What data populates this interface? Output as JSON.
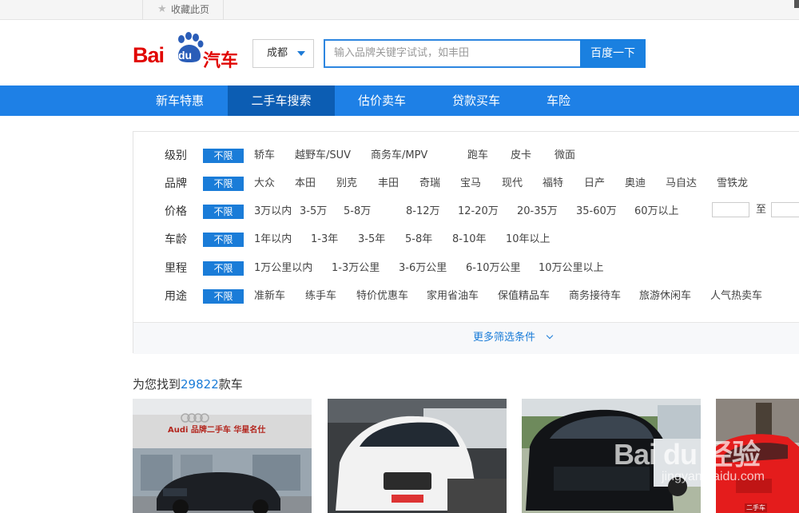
{
  "topbar": {
    "favorite_label": "收藏此页",
    "star_icon": "star-icon"
  },
  "logo": {
    "bai": "Bai",
    "du": "du",
    "qiche": "汽车"
  },
  "search": {
    "city": "成都",
    "placeholder": "输入品牌关键字试试，如丰田",
    "button": "百度一下"
  },
  "nav": {
    "items": [
      "新车特惠",
      "二手车搜索",
      "估价卖车",
      "贷款买车",
      "车险"
    ],
    "active": 1
  },
  "filters": {
    "no_limit": "不限",
    "rows": [
      {
        "label": "级别",
        "options": [
          "轿车",
          "越野车/SUV",
          "商务车/MPV",
          "跑车",
          "皮卡",
          "微面"
        ]
      },
      {
        "label": "品牌",
        "options": [
          "大众",
          "本田",
          "别克",
          "丰田",
          "奇瑞",
          "宝马",
          "现代",
          "福特",
          "日产",
          "奥迪",
          "马自达",
          "雪铁龙"
        ]
      },
      {
        "label": "价格",
        "options": [
          "3万以内",
          "3-5万",
          "5-8万",
          "8-12万",
          "12-20万",
          "20-35万",
          "35-60万",
          "60万以上"
        ]
      },
      {
        "label": "车龄",
        "options": [
          "1年以内",
          "1-3年",
          "3-5年",
          "5-8年",
          "8-10年",
          "10年以上"
        ]
      },
      {
        "label": "里程",
        "options": [
          "1万公里以内",
          "1-3万公里",
          "3-6万公里",
          "6-10万公里",
          "10万公里以上"
        ]
      },
      {
        "label": "用途",
        "options": [
          "准新车",
          "练手车",
          "特价优惠车",
          "家用省油车",
          "保值精品车",
          "商务接待车",
          "旅游休闲车",
          "人气热卖车"
        ]
      }
    ],
    "price_to": "至",
    "more": "更多筛选条件"
  },
  "result": {
    "prefix": "为您找到",
    "count": "29822",
    "suffix": "款车"
  },
  "photos": {
    "card1_sign": "Audi  品牌二手车  华星名仕",
    "card4_sticker": "二手车",
    "watermark": "Bai du 经验",
    "watermark_url": "jingyan.baidu.com"
  },
  "colors": {
    "brand_red": "#e10602",
    "nav_blue": "#1e80e6",
    "nav_active": "#0c5db3",
    "accent_blue": "#1a7cd8"
  }
}
